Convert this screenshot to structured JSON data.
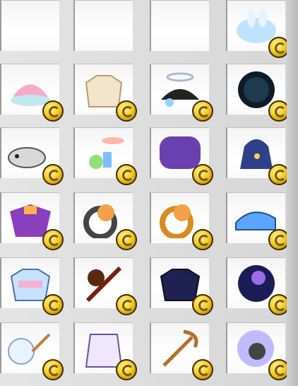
{
  "inventory": {
    "rows": [
      {
        "items": [
          "empty-slot",
          "empty-slot",
          "empty-slot",
          "blue-bunny-ghost"
        ]
      },
      {
        "items": [
          "pink-lotus",
          "cream-sweater",
          "angel-halo-glasses",
          "dark-orb"
        ]
      },
      {
        "items": [
          "gray-fish-ghost",
          "potion-bottles",
          "purple-sparkle-cloud",
          "starry-pouch"
        ]
      },
      {
        "items": [
          "purple-bat-cape",
          "orange-cat-ring-dark",
          "orange-cat-ring-gold",
          "blue-sneaker"
        ]
      },
      {
        "items": [
          "blue-bunny-sweater",
          "flaming-sword",
          "navy-suit-jacket",
          "fireworks-orb"
        ]
      },
      {
        "items": [
          "sakura-fan",
          "white-purple-outfit",
          "crescent-staff",
          "shield-bubble-mascot"
        ]
      }
    ],
    "coin_icon": "gold-coin-icon",
    "colors": {
      "slot_bg": "#ffffff",
      "slot_border": "#9a9a9a",
      "coin": "#f6cf2a"
    }
  }
}
